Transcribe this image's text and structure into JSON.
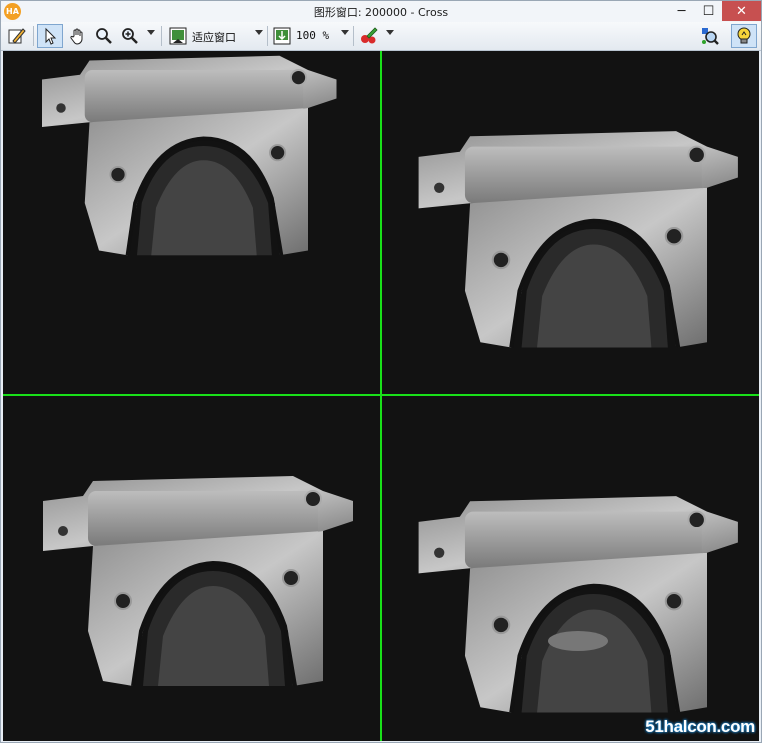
{
  "window": {
    "app_icon": "HA",
    "title": "图形窗口: 200000 - Cross",
    "minimize": "─",
    "maximize": "☐",
    "close": "✕"
  },
  "toolbar": {
    "zoom_fit_label": "适应窗口",
    "zoom_percent_label": "100 %"
  },
  "canvas": {
    "crosshair_color": "#19e019",
    "watermark": "51halcon.com"
  }
}
